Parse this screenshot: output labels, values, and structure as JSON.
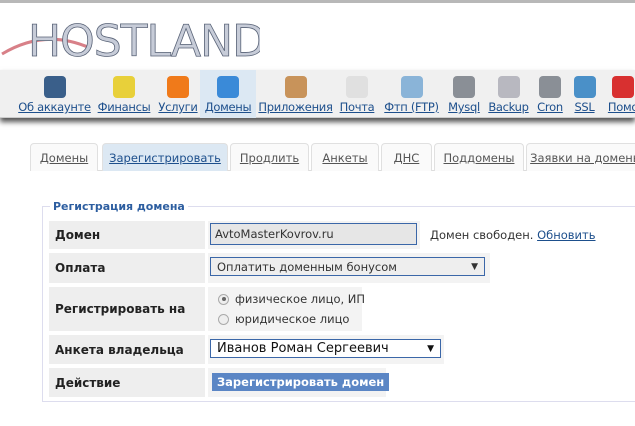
{
  "logo": {
    "text": "HOSTLAND"
  },
  "nav": [
    {
      "label": "Об аккаунте",
      "icon": "id-card-icon",
      "color": "#3a5f8a"
    },
    {
      "label": "Финансы",
      "icon": "coins-icon",
      "color": "#e8d03a"
    },
    {
      "label": "Услуги",
      "icon": "orange-icon",
      "color": "#f07a1a"
    },
    {
      "label": "Домены",
      "icon": "globe-icon",
      "color": "#3a8ad8",
      "active": true
    },
    {
      "label": "Приложения",
      "icon": "box-icon",
      "color": "#c8935a"
    },
    {
      "label": "Почта",
      "icon": "mail-icon",
      "color": "#e0e0e0"
    },
    {
      "label": "Фтп (FTP)",
      "icon": "folder-icon",
      "color": "#8ab4d8"
    },
    {
      "label": "Mysql",
      "icon": "database-icon",
      "color": "#8a8f96"
    },
    {
      "label": "Backup",
      "icon": "disc-icon",
      "color": "#b8b8c0"
    },
    {
      "label": "Cron",
      "icon": "clock-icon",
      "color": "#8a8f96"
    },
    {
      "label": "SSL",
      "icon": "lock-icon",
      "color": "#4a90c8"
    },
    {
      "label": "Помо",
      "icon": "lifebuoy-icon",
      "color": "#d83030"
    }
  ],
  "tabs": [
    "Домены",
    "Зарегистрировать",
    "Продлить",
    "Анкеты",
    "ДНС",
    "Поддомены",
    "Заявки на домены"
  ],
  "form": {
    "legend": "Регистрация домена",
    "domain_label": "Домен",
    "domain_value": "AvtoMasterKovrov.ru",
    "status_text": "Домен свободен.",
    "refresh_link": "Обновить",
    "payment_label": "Оплата",
    "payment_value": "Оплатить доменным бонусом",
    "register_label": "Регистрировать на",
    "radio_individual": "физическое лицо, ИП",
    "radio_legal": "юридическое лицо",
    "owner_label": "Анкета владельца",
    "owner_value": "Иванов Роман Сергеевич",
    "action_label": "Действие",
    "submit": "Зарегистрировать домен"
  }
}
